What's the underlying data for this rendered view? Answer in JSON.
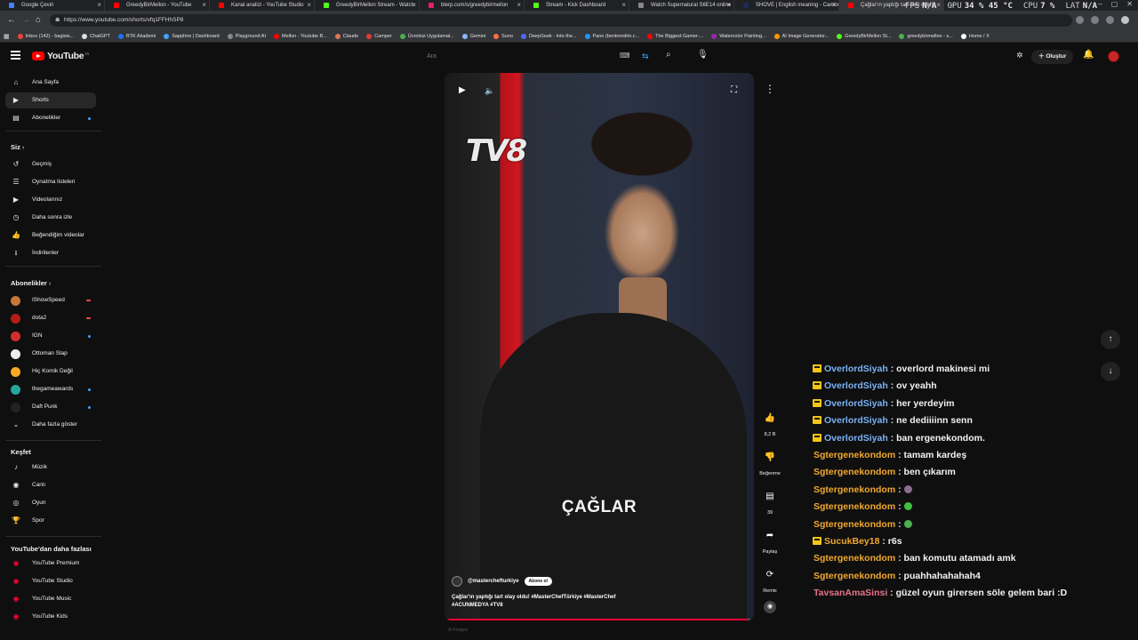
{
  "browser": {
    "tabs": [
      {
        "label": "Google Çeviri",
        "color": "#4285f4"
      },
      {
        "label": "GreedyBirMellon - YouTube",
        "color": "#ff0000"
      },
      {
        "label": "Kanal analizi - YouTube Studio",
        "color": "#ff0000"
      },
      {
        "label": "GreedyBirMellon Stream - Watch",
        "color": "#53fc18"
      },
      {
        "label": "blerp.com/s/greedybirmellon",
        "color": "#e91e63"
      },
      {
        "label": "Stream - Kick Dashboard",
        "color": "#53fc18"
      },
      {
        "label": "Watch Supernatural S6E14 online",
        "color": "#888888"
      },
      {
        "label": "SHOVE | English meaning - Cambr",
        "color": "#1d2a57"
      },
      {
        "label": "Çağlar'ın yaptığı tart olay oldu!",
        "color": "#ff0000",
        "active": true
      }
    ],
    "url": "https://www.youtube.com/shorts/vfq1FFHhSP8",
    "overlay": {
      "fps_label": "FPS",
      "fps": "N/A",
      "gpu_label": "GPU",
      "gpu": "34 % 45 °C",
      "cpu_label": "CPU",
      "cpu": "7 %",
      "lat_label": "LAT",
      "lat": "N/A"
    },
    "bookmarks": [
      {
        "label": "Inbox (142) - bagisis...",
        "color": "#ea4335"
      },
      {
        "label": "ChatGPT",
        "color": "#dddddd"
      },
      {
        "label": "BTK Akademi",
        "color": "#1a73e8"
      },
      {
        "label": "Sapphire | Dashboard",
        "color": "#3ea6ff"
      },
      {
        "label": "Playground AI",
        "color": "#888888"
      },
      {
        "label": "Mellon - Youtube B...",
        "color": "#ff0000"
      },
      {
        "label": "Claude",
        "color": "#d97757"
      },
      {
        "label": "Camper",
        "color": "#e53935"
      },
      {
        "label": "Ücretsiz Uygulamal...",
        "color": "#4caf50"
      },
      {
        "label": "Gemini",
        "color": "#8ab4f8"
      },
      {
        "label": "Suno",
        "color": "#ff7043"
      },
      {
        "label": "DeepSeek - Into the...",
        "color": "#4d6bfe"
      },
      {
        "label": "Pano (bentrendim.c...",
        "color": "#2196f3"
      },
      {
        "label": "The Biggest Gamer-...",
        "color": "#ff0000"
      },
      {
        "label": "Watercolor Painting...",
        "color": "#9c27b0"
      },
      {
        "label": "AI Image Generator...",
        "color": "#ff9800"
      },
      {
        "label": "GreedyBirMellon St...",
        "color": "#53fc18"
      },
      {
        "label": "greedybirmellon - s...",
        "color": "#4caf50"
      },
      {
        "label": "Home / X",
        "color": "#ffffff"
      }
    ]
  },
  "header": {
    "logo": "YouTube",
    "logo_sup": "TR",
    "search_placeholder": "Ara",
    "create_label": "Oluştur"
  },
  "sidebar": {
    "main": [
      {
        "label": "Ana Sayfa",
        "icon": "⌂",
        "name": "home"
      },
      {
        "label": "Shorts",
        "icon": "▶",
        "name": "shorts",
        "active": true
      },
      {
        "label": "Abonelikler",
        "icon": "▤",
        "name": "subscriptions",
        "dot": true
      }
    ],
    "you_title": "Siz",
    "you": [
      {
        "label": "Geçmiş",
        "icon": "↺",
        "name": "history"
      },
      {
        "label": "Oynatma listeleri",
        "icon": "☰",
        "name": "playlists"
      },
      {
        "label": "Videolarınız",
        "icon": "▶",
        "name": "your-videos"
      },
      {
        "label": "Daha sonra izle",
        "icon": "◷",
        "name": "watch-later"
      },
      {
        "label": "Beğendiğim videolar",
        "icon": "👍",
        "name": "liked-videos"
      },
      {
        "label": "İndirilenler",
        "icon": "⭳",
        "name": "downloads"
      }
    ],
    "subs_title": "Abonelikler",
    "subs": [
      {
        "label": "IShowSpeed",
        "color": "#c7763a",
        "live": "red"
      },
      {
        "label": "dota2",
        "color": "#b71c1c",
        "live": "red"
      },
      {
        "label": "IGN",
        "color": "#d32f2f",
        "live": "blue"
      },
      {
        "label": "Ottoman Slap",
        "color": "#eeeeee"
      },
      {
        "label": "Hiç Komik Değil",
        "color": "#f9a825"
      },
      {
        "label": "thegameawards",
        "color": "#26a69a",
        "live": "blue"
      },
      {
        "label": "Daft Punk",
        "color": "#222222",
        "live": "blue"
      }
    ],
    "show_more": "Daha fazla göster",
    "explore_title": "Keşfet",
    "explore": [
      {
        "label": "Müzik",
        "icon": "♪",
        "name": "music"
      },
      {
        "label": "Canlı",
        "icon": "◉",
        "name": "live"
      },
      {
        "label": "Oyun",
        "icon": "◎",
        "name": "gaming"
      },
      {
        "label": "Spor",
        "icon": "🏆",
        "name": "sports"
      }
    ],
    "more_title": "YouTube'dan daha fazlası",
    "more": [
      {
        "label": "YouTube Premium"
      },
      {
        "label": "YouTube Studio"
      },
      {
        "label": "YouTube Music"
      },
      {
        "label": "YouTube Kids"
      }
    ]
  },
  "video": {
    "channel_logo": "TV8",
    "name_overlay": "ÇAĞLAR",
    "channel": "@masterchefturkiye",
    "subscribe": "Abone ol",
    "caption_line1": "Çağlar'ın yaptığı tart olay oldu! #MasterChefTürkiye #MasterChef",
    "caption_line2": "#ACUNMEDYA #TV8",
    "progress": 0.98,
    "below_text": "Ai Images"
  },
  "actions": {
    "like_count": "8,2 B",
    "dislike_label": "Beğenme",
    "comments_count": "39",
    "share_label": "Paylaş",
    "remix_label": "Remix"
  },
  "chat": [
    {
      "user": "OverlordSiyah",
      "color": "#7ab2f5",
      "badge": true,
      "msg": "overlord makinesi mi"
    },
    {
      "user": "OverlordSiyah",
      "color": "#7ab2f5",
      "badge": true,
      "msg": "ov yeahh"
    },
    {
      "user": "OverlordSiyah",
      "color": "#7ab2f5",
      "badge": true,
      "msg": "her yerdeyim"
    },
    {
      "user": "OverlordSiyah",
      "color": "#7ab2f5",
      "badge": true,
      "msg": "ne dediiiinn senn"
    },
    {
      "user": "OverlordSiyah",
      "color": "#7ab2f5",
      "badge": true,
      "msg": "ban ergenekondom."
    },
    {
      "user": "Sgtergenekondom",
      "color": "#f0a830",
      "msg": "tamam kardeş"
    },
    {
      "user": "Sgtergenekondom",
      "color": "#f0a830",
      "msg": "ben çıkarım"
    },
    {
      "user": "Sgtergenekondom",
      "color": "#f0a830",
      "msg": "",
      "emote": "#8a6d8f"
    },
    {
      "user": "Sgtergenekondom",
      "color": "#f0a830",
      "msg": "",
      "emote": "#3fbf3f"
    },
    {
      "user": "Sgtergenekondom",
      "color": "#f0a830",
      "msg": "",
      "emote": "#4caf50"
    },
    {
      "user": "SucukBey18",
      "color": "#f0a830",
      "badge": true,
      "msg": "r6s"
    },
    {
      "user": "Sgtergenekondom",
      "color": "#f0a830",
      "msg": "ban komutu atamadı amk"
    },
    {
      "user": "Sgtergenekondom",
      "color": "#f0a830",
      "msg": "puahhahahahah4"
    },
    {
      "user": "TavsanAmaSinsi",
      "color": "#e8738a",
      "msg": "güzel oyun girersen söle gelem bari :D"
    }
  ]
}
